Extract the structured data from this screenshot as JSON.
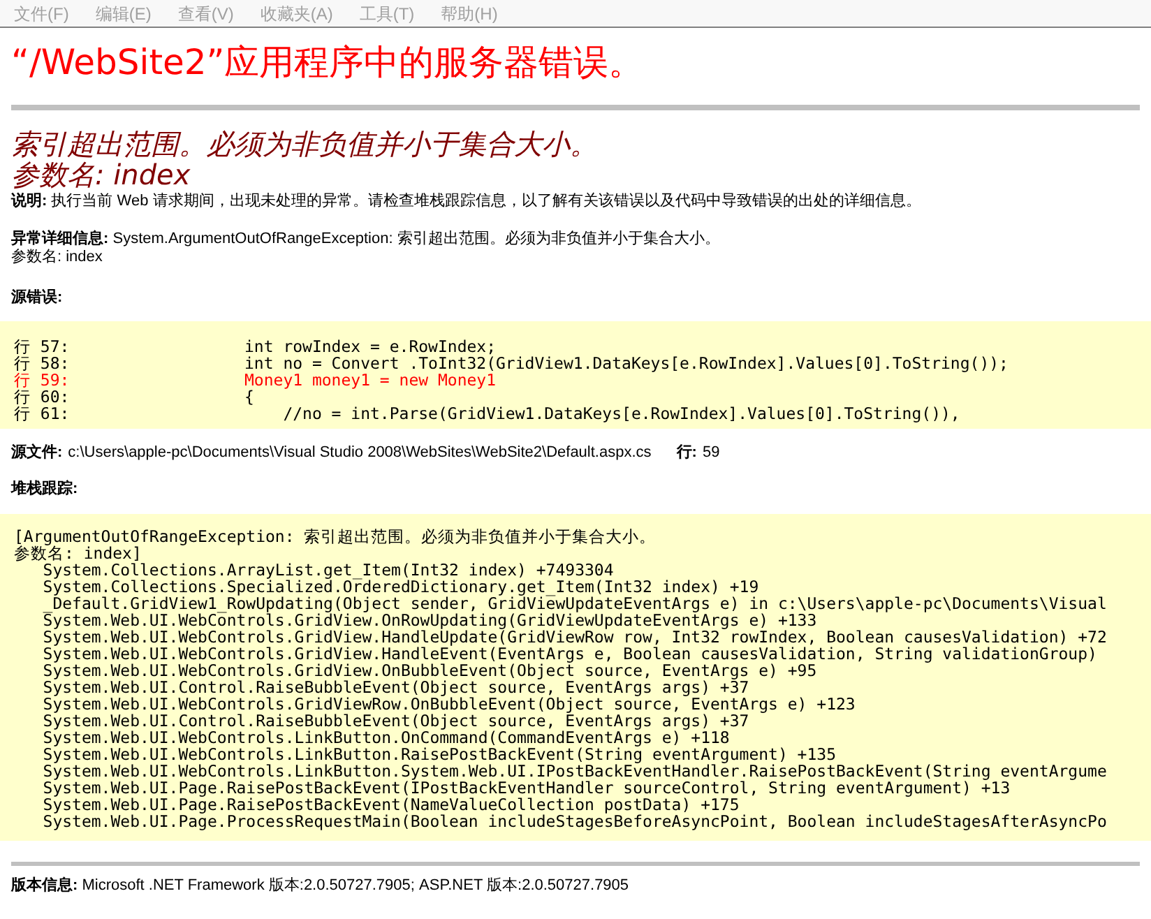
{
  "menu_bar": [
    {
      "label": "文件(F)",
      "disabled": true
    },
    {
      "label": "编辑(E)",
      "disabled": true
    },
    {
      "label": "查看(V)",
      "disabled": true
    },
    {
      "label": "收藏夹(A)",
      "disabled": true
    },
    {
      "label": "工具(T)",
      "disabled": true
    },
    {
      "label": "帮助(H)",
      "disabled": true
    }
  ],
  "page_title": "“/WebSite2”应用程序中的服务器错误。",
  "error_heading": [
    "索引超出范围。必须为非负值并小于集合大小。",
    "参数名: index"
  ],
  "description": {
    "label": "说明:",
    "text": "执行当前 Web 请求期间，出现未处理的异常。请检查堆栈跟踪信息，以了解有关该错误以及代码中导致错误的出处的详细信息。"
  },
  "exception_details": {
    "label": "异常详细信息:",
    "lines": [
      "System.ArgumentOutOfRangeException: 索引超出范围。必须为非负值并小于集合大小。",
      "参数名: index"
    ]
  },
  "source_error": {
    "label": "源错误:",
    "lines": [
      {
        "number": "行 57:",
        "code": "int rowIndex = e.RowIndex;",
        "highlighted": false
      },
      {
        "number": "行 58:",
        "code": "int no = Convert .ToInt32(GridView1.DataKeys[e.RowIndex].Values[0].ToString());",
        "highlighted": false
      },
      {
        "number": "行 59:",
        "code": "Money1 money1 = new Money1",
        "highlighted": true
      },
      {
        "number": "行 60:",
        "code": "{",
        "highlighted": false
      },
      {
        "number": "行 61:",
        "code": "    //no = int.Parse(GridView1.DataKeys[e.RowIndex].Values[0].ToString()),",
        "highlighted": false
      }
    ]
  },
  "source_file": {
    "label": "源文件:",
    "path": "c:\\Users\\apple-pc\\Documents\\Visual Studio 2008\\WebSites\\WebSite2\\Default.aspx.cs",
    "line_label": "行:",
    "line": "59"
  },
  "stack_trace": {
    "label": "堆栈跟踪:",
    "lines": [
      "[ArgumentOutOfRangeException: 索引超出范围。必须为非负值并小于集合大小。",
      "参数名: index]",
      "   System.Collections.ArrayList.get_Item(Int32 index) +7493304",
      "   System.Collections.Specialized.OrderedDictionary.get_Item(Int32 index) +19",
      "   _Default.GridView1_RowUpdating(Object sender, GridViewUpdateEventArgs e) in c:\\Users\\apple-pc\\Documents\\Visual",
      "   System.Web.UI.WebControls.GridView.OnRowUpdating(GridViewUpdateEventArgs e) +133",
      "   System.Web.UI.WebControls.GridView.HandleUpdate(GridViewRow row, Int32 rowIndex, Boolean causesValidation) +72",
      "   System.Web.UI.WebControls.GridView.HandleEvent(EventArgs e, Boolean causesValidation, String validationGroup)",
      "   System.Web.UI.WebControls.GridView.OnBubbleEvent(Object source, EventArgs e) +95",
      "   System.Web.UI.Control.RaiseBubbleEvent(Object source, EventArgs args) +37",
      "   System.Web.UI.WebControls.GridViewRow.OnBubbleEvent(Object source, EventArgs e) +123",
      "   System.Web.UI.Control.RaiseBubbleEvent(Object source, EventArgs args) +37",
      "   System.Web.UI.WebControls.LinkButton.OnCommand(CommandEventArgs e) +118",
      "   System.Web.UI.WebControls.LinkButton.RaisePostBackEvent(String eventArgument) +135",
      "   System.Web.UI.WebControls.LinkButton.System.Web.UI.IPostBackEventHandler.RaisePostBackEvent(String eventArgume",
      "   System.Web.UI.Page.RaisePostBackEvent(IPostBackEventHandler sourceControl, String eventArgument) +13",
      "   System.Web.UI.Page.RaisePostBackEvent(NameValueCollection postData) +175",
      "   System.Web.UI.Page.ProcessRequestMain(Boolean includeStagesBeforeAsyncPoint, Boolean includeStagesAfterAsyncPo"
    ]
  },
  "version_info": {
    "label": "版本信息:",
    "text": "Microsoft .NET Framework 版本:2.0.50727.7905; ASP.NET 版本:2.0.50727.7905"
  }
}
